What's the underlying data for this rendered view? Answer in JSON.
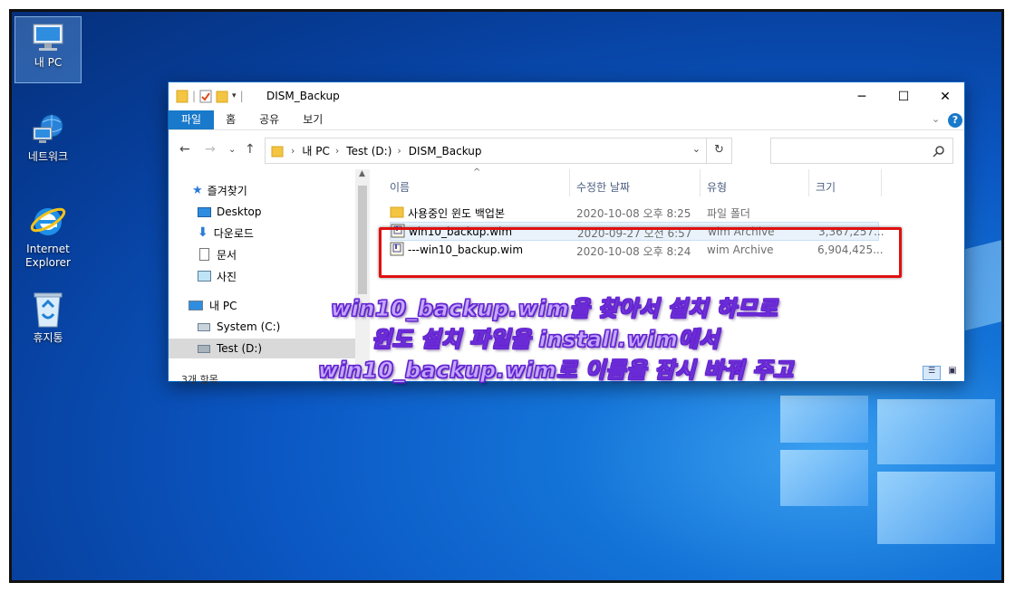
{
  "desktop": {
    "icons": [
      {
        "label": "내 PC",
        "icon": "computer-icon"
      },
      {
        "label": "네트워크",
        "icon": "network-icon"
      },
      {
        "label": "Internet\nExplorer",
        "icon": "ie-icon"
      },
      {
        "label": "휴지통",
        "icon": "recycle-bin-icon"
      }
    ]
  },
  "window": {
    "title": "DISM_Backup",
    "controls": {
      "minimize": "─",
      "maximize": "☐",
      "close": "✕"
    },
    "ribbon_tabs": [
      "파일",
      "홈",
      "공유",
      "보기"
    ],
    "address": {
      "crumbs": [
        "내 PC",
        "Test (D:)",
        "DISM_Backup"
      ]
    },
    "search": {
      "placeholder": ""
    },
    "nav": {
      "quick_access": "즐겨찾기",
      "items": [
        "Desktop",
        "다운로드",
        "문서",
        "사진"
      ],
      "this_pc": "내 PC",
      "drives": [
        "System (C:)",
        "Test (D:)"
      ]
    },
    "columns": [
      "이름",
      "수정한 날짜",
      "유형",
      "크기"
    ],
    "files": [
      {
        "name": "사용중인 윈도 백업본",
        "date": "2020-10-08 오후 8:25",
        "type": "파일 폴더",
        "size": ""
      },
      {
        "name": "win10_backup.wim",
        "date": "2020-09-27 오전 6:57",
        "type": "wim Archive",
        "size": "3,367,257..."
      },
      {
        "name": "---win10_backup.wim",
        "date": "2020-10-08 오후 8:24",
        "type": "wim Archive",
        "size": "6,904,425..."
      }
    ],
    "status": "3개 항목"
  },
  "annotation": {
    "lines": [
      "win10_backup.wim을 찾아서 설치 하므로",
      "윈도 설치 파일을 install.wim에서",
      "win10_backup.wim로 이름을 잠시 바꿔 주고"
    ],
    "color": "#c4a8ff",
    "highlight_color": "#e01010"
  }
}
